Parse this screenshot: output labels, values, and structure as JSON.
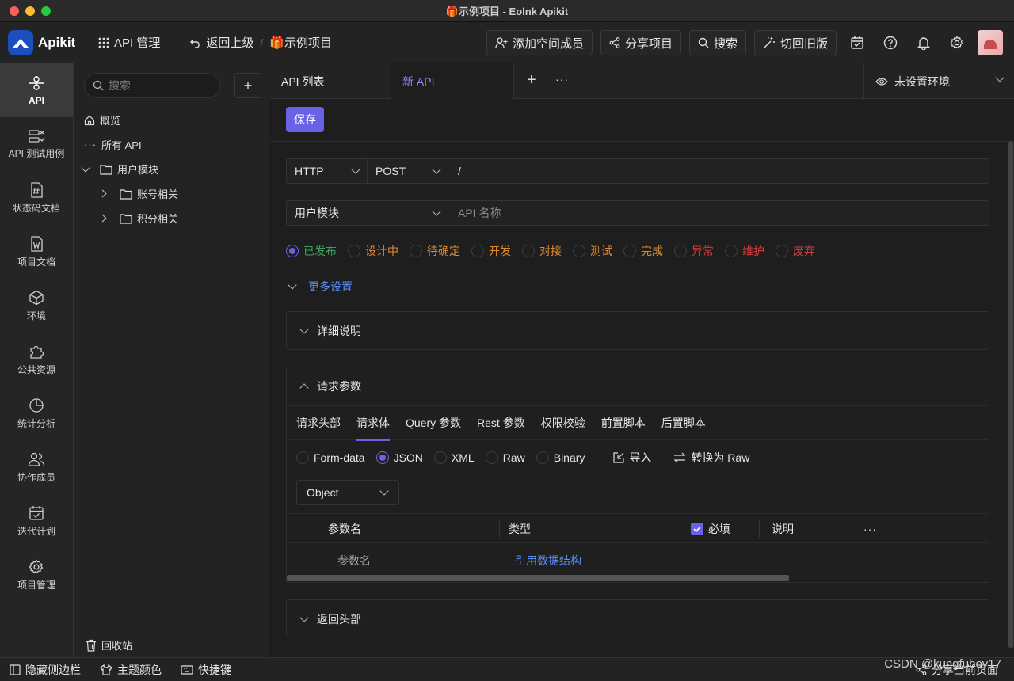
{
  "window": {
    "title": "🎁示例项目 - Eolnk Apikit"
  },
  "topbar": {
    "logo": "Apikit",
    "api_manage": "API 管理",
    "back": "返回上级",
    "project": "🎁示例项目",
    "add_member": "添加空间成员",
    "share": "分享项目",
    "search": "搜索",
    "old_version": "切回旧版"
  },
  "leftnav": {
    "items": [
      {
        "label": "API"
      },
      {
        "label": "API 测试用例"
      },
      {
        "label": "状态码文档"
      },
      {
        "label": "项目文档"
      },
      {
        "label": "环境"
      },
      {
        "label": "公共资源"
      },
      {
        "label": "统计分析"
      },
      {
        "label": "协作成员"
      },
      {
        "label": "迭代计划"
      },
      {
        "label": "项目管理"
      }
    ]
  },
  "tree": {
    "search_placeholder": "搜索",
    "overview": "概览",
    "all_api": "所有 API",
    "group": "用户模块",
    "children": [
      "账号相关",
      "积分相关"
    ],
    "trash": "回收站"
  },
  "tabs": {
    "list": "API 列表",
    "new": "新 API",
    "env": "未设置环境"
  },
  "form": {
    "save": "保存",
    "protocol": "HTTP",
    "method": "POST",
    "path": "/",
    "group": "用户模块",
    "name_placeholder": "API 名称",
    "status": [
      {
        "label": "已发布",
        "color": "#3aa35a",
        "selected": true
      },
      {
        "label": "设计中",
        "color": "#e08a2c"
      },
      {
        "label": "待确定",
        "color": "#e08a2c"
      },
      {
        "label": "开发",
        "color": "#e08a2c"
      },
      {
        "label": "对接",
        "color": "#e08a2c"
      },
      {
        "label": "测试",
        "color": "#e08a2c"
      },
      {
        "label": "完成",
        "color": "#e08a2c"
      },
      {
        "label": "异常",
        "color": "#d43b3b"
      },
      {
        "label": "维护",
        "color": "#d43b3b"
      },
      {
        "label": "废弃",
        "color": "#d43b3b"
      }
    ],
    "more_settings": "更多设置"
  },
  "panels": {
    "detail": "详细说明",
    "request": "请求参数",
    "response_header": "返回头部"
  },
  "request": {
    "subtabs": [
      "请求头部",
      "请求体",
      "Query 参数",
      "Rest 参数",
      "权限校验",
      "前置脚本",
      "后置脚本"
    ],
    "body_types": [
      "Form-data",
      "JSON",
      "XML",
      "Raw",
      "Binary"
    ],
    "import": "导入",
    "convert": "转换为 Raw",
    "object": "Object",
    "table_headers": {
      "name": "参数名",
      "type": "类型",
      "required": "必填",
      "desc": "说明",
      "more": "···"
    },
    "row": {
      "name_placeholder": "参数名",
      "ref": "引用数据结构"
    }
  },
  "bottombar": {
    "hide_sidebar": "隐藏侧边栏",
    "theme": "主题颜色",
    "shortcuts": "快捷键",
    "share_page": "分享当前页面",
    "watermark": "CSDN @kungfuboy17"
  }
}
